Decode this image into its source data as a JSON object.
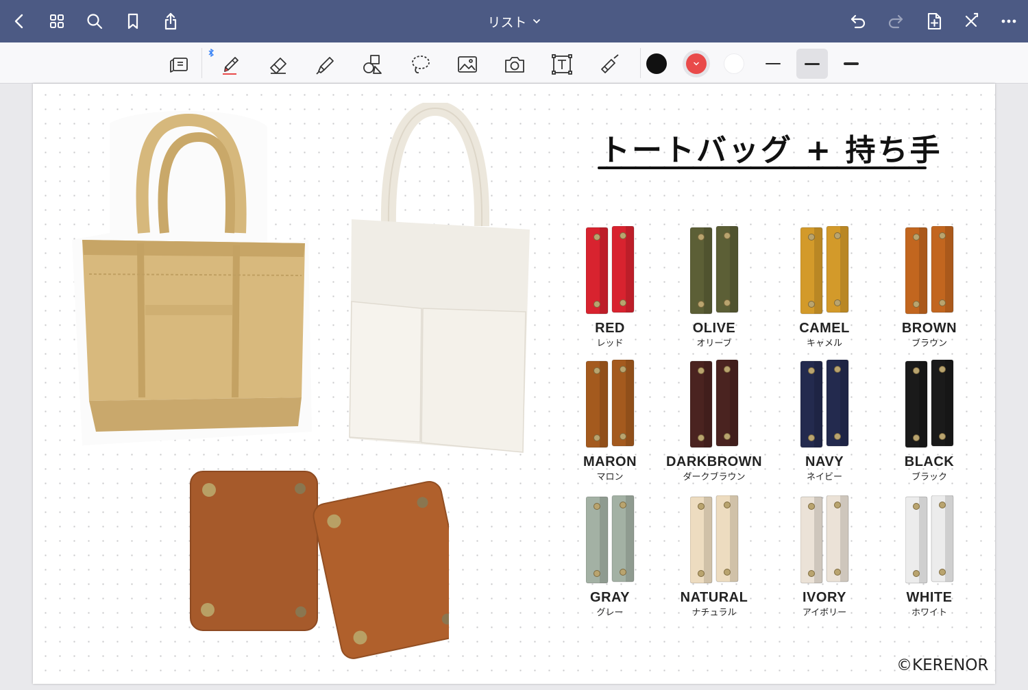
{
  "topbar": {
    "title": "リスト",
    "icons": [
      "back-icon",
      "grid-icon",
      "search-icon",
      "bookmark-icon",
      "share-icon",
      "undo-icon",
      "redo-icon",
      "add-page-icon",
      "close-x-icon",
      "more-icon"
    ]
  },
  "toolbar": {
    "tools": [
      "read-mode-icon",
      "pen-icon",
      "eraser-icon",
      "highlighter-icon",
      "shapes-icon",
      "lasso-icon",
      "image-icon",
      "camera-icon",
      "text-box-icon",
      "laser-pointer-icon"
    ],
    "colors": [
      "#111111",
      "#e94a4a",
      "#ffffff"
    ],
    "selected_stroke": "medium"
  },
  "page": {
    "heading": "トートバッグ + 持ち手",
    "copyright": "©KERENOR",
    "handles": [
      {
        "name": "RED",
        "kana": "レッド",
        "color": "#d8232f"
      },
      {
        "name": "OLIVE",
        "kana": "オリーブ",
        "color": "#5c5f36"
      },
      {
        "name": "CAMEL",
        "kana": "キャメル",
        "color": "#d39a2a"
      },
      {
        "name": "BROWN",
        "kana": "ブラウン",
        "color": "#c2661f"
      },
      {
        "name": "MARON",
        "kana": "マロン",
        "color": "#a45a1e"
      },
      {
        "name": "DARKBROWN",
        "kana": "ダークブラウン",
        "color": "#4a2320"
      },
      {
        "name": "NAVY",
        "kana": "ネイビー",
        "color": "#232a4e"
      },
      {
        "name": "BLACK",
        "kana": "ブラック",
        "color": "#1a1a1a"
      },
      {
        "name": "GRAY",
        "kana": "グレー",
        "color": "#a3b1a4"
      },
      {
        "name": "NATURAL",
        "kana": "ナチュラル",
        "color": "#eddcc0"
      },
      {
        "name": "IVORY",
        "kana": "アイボリー",
        "color": "#ebe2d7"
      },
      {
        "name": "WHITE",
        "kana": "ホワイト",
        "color": "#ececec"
      }
    ]
  }
}
